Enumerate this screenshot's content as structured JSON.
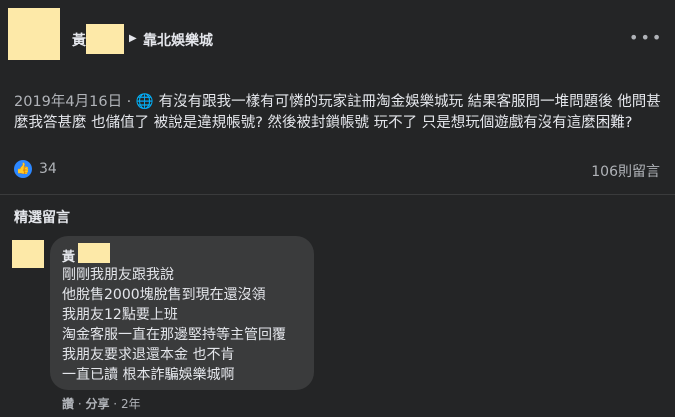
{
  "post": {
    "author_name": "黃",
    "group_name": "靠北娛樂城",
    "date": "2019年4月16日",
    "meta_separator": " · ",
    "text": "有沒有跟我一樣有可憐的玩家註冊淘金娛樂城玩 結果客服問一堆問題後 他問甚麼我答甚麼 也儲值了 被說是違規帳號? 然後被封鎖帳號 玩不了 只是想玩個遊戲有沒有這麼困難?",
    "like_count": "34",
    "comment_count": "106則留言"
  },
  "comments_section": {
    "title": "精選留言"
  },
  "comment": {
    "author_name": "黃",
    "lines": [
      "剛剛我朋友跟我說",
      "他脫售2000塊脫售到現在還沒領",
      "我朋友12點要上班",
      "淘金客服一直在那邊堅持等主管回覆",
      "我朋友要求退還本金 也不肯",
      "一直已讀 根本詐騙娛樂城啊"
    ],
    "actions": {
      "like": "讚",
      "share": "分享",
      "time": "2年",
      "separator": " · "
    }
  },
  "icons": {
    "globe": "globe-icon",
    "like": "thumbs-up-icon",
    "more": "more-icon",
    "arrow": "arrow-right-icon"
  },
  "colors": {
    "background": "#242526",
    "bubble": "#3a3b3c",
    "like_blue": "#2d88ff",
    "redaction": "#fde9a8"
  }
}
